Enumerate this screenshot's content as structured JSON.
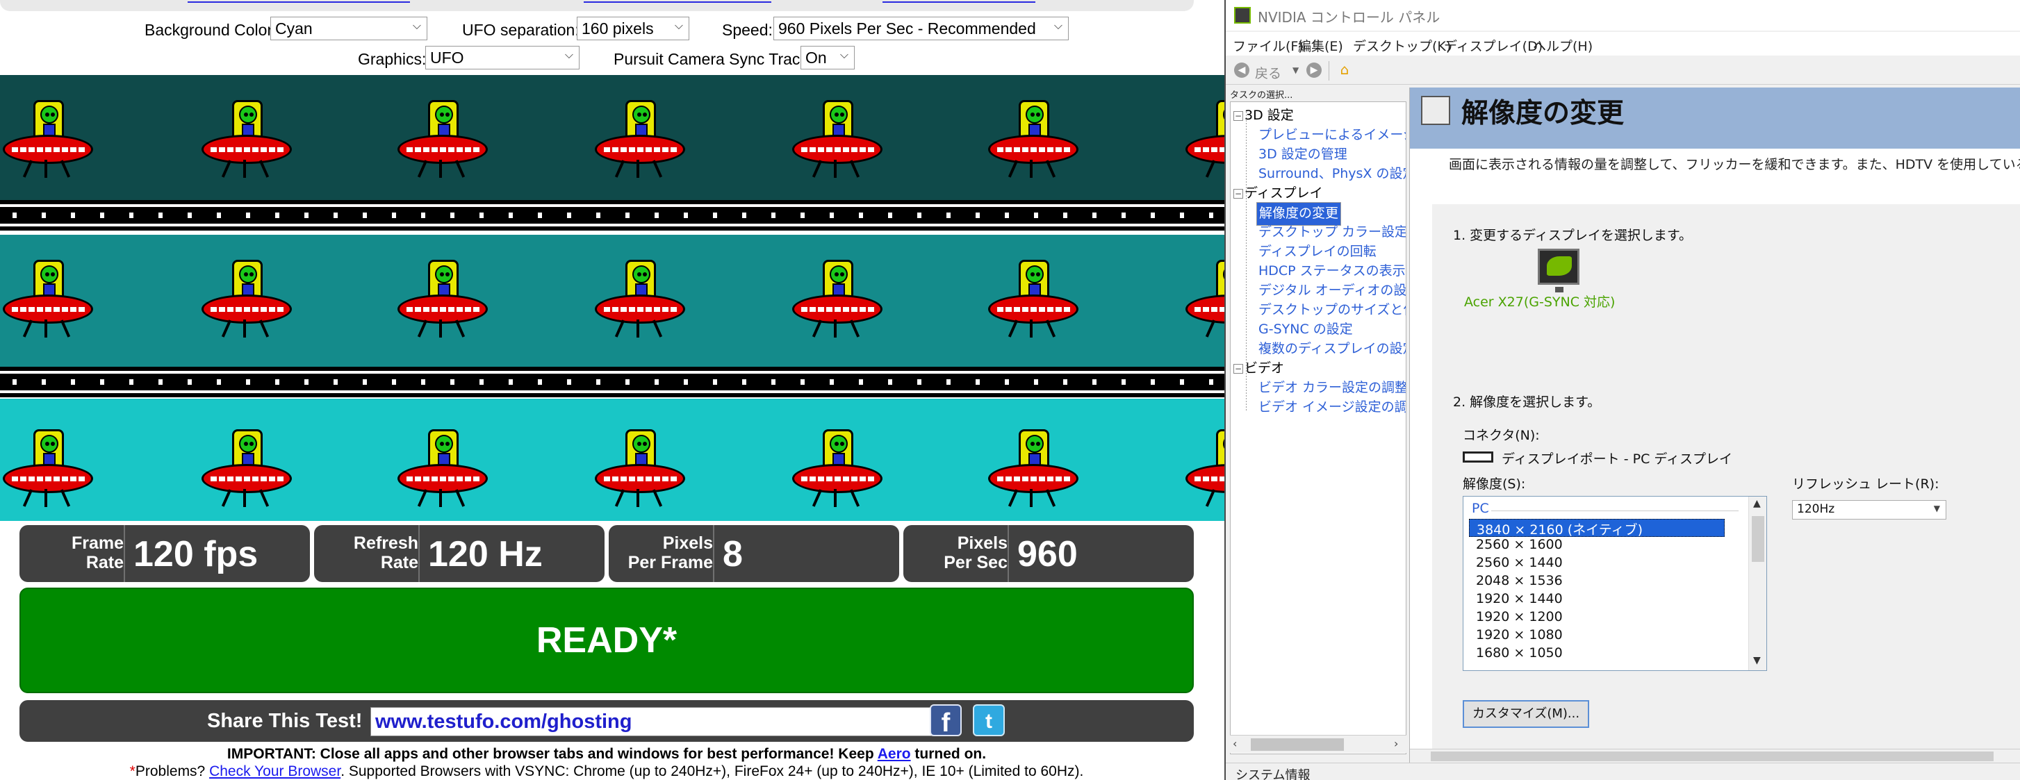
{
  "testufo": {
    "controls_row1": {
      "background_label": "Background Color:",
      "background_value": "Cyan",
      "separation_label": "UFO separation:",
      "separation_value": "160 pixels",
      "speed_label": "Speed:",
      "speed_value": "960 Pixels Per Sec - Recommended"
    },
    "controls_row2": {
      "graphics_label": "Graphics:",
      "graphics_value": "UFO",
      "sync_label": "Pursuit Camera Sync Track:",
      "sync_value": "On"
    },
    "bands": [
      {
        "color": "#0f4a4a"
      },
      {
        "color": "#148b8b"
      },
      {
        "color": "#19c6c6"
      }
    ],
    "stats": [
      {
        "label_line1": "Frame",
        "label_line2": "Rate",
        "value": "120 fps"
      },
      {
        "label_line1": "Refresh",
        "label_line2": "Rate",
        "value": "120 Hz"
      },
      {
        "label_line1": "Pixels",
        "label_line2": "Per Frame",
        "value": "8"
      },
      {
        "label_line1": "Pixels",
        "label_line2": "Per Sec",
        "value": "960"
      }
    ],
    "status": "READY*",
    "share": {
      "label": "Share This Test!",
      "url": "www.testufo.com/ghosting",
      "facebook_icon": "facebook-icon",
      "twitter_icon": "twitter-icon"
    },
    "notice": {
      "important_prefix": "IMPORTANT: Close all apps and other browser tabs and windows for best performance! Keep ",
      "aero_link": "Aero",
      "important_suffix": " turned on.",
      "star": "*",
      "problems": "Problems? ",
      "check_link": "Check Your Browser",
      "supported": ". Supported Browsers with VSYNC: Chrome (up to 240Hz+), FireFox 24+ (up to 240Hz+), IE 10+ (Limited to 60Hz)."
    }
  },
  "nvidia": {
    "title": "NVIDIA コントロール パネル",
    "menu": [
      "ファイル(F)",
      "編集(E)",
      "デスクトップ(K)",
      "ディスプレイ(D)",
      "ヘルプ(H)"
    ],
    "toolbar": {
      "back": "戻る"
    },
    "task_label": "タスクの選択...",
    "tree": {
      "cat_3d": "3D 設定",
      "items_3d": [
        "プレビューによるイメージ設定の調整",
        "3D 設定の管理",
        "Surround、PhysX の設定"
      ],
      "cat_display": "ディスプレイ",
      "items_display": [
        "解像度の変更",
        "デスクトップ カラー設定の調整",
        "ディスプレイの回転",
        "HDCP ステータスの表示",
        "デジタル オーディオの設定",
        "デスクトップのサイズと位置の調整",
        "G-SYNC の設定",
        "複数のディスプレイの設定"
      ],
      "cat_video": "ビデオ",
      "items_video": [
        "ビデオ カラー設定の調整",
        "ビデオ イメージ設定の調整"
      ]
    },
    "page_title": "解像度の変更",
    "description": "画面に表示される情報の量を調整して、フリッカーを緩和できます。また、HDTV を使用している場合にも...",
    "step1": "1. 変更するディスプレイを選択します。",
    "monitor_label": "Acer X27(G-SYNC 対応)",
    "step2": "2. 解像度を選択します。",
    "connector_label": "コネクタ(N):",
    "connector_value": "ディスプレイポート - PC ディスプレイ",
    "resolution_label": "解像度(S):",
    "refresh_label": "リフレッシュ レート(R):",
    "refresh_value": "120Hz",
    "resolution_group": "PC",
    "resolutions": [
      "3840 × 2160 (ネイティブ)",
      "2560 × 1600",
      "2560 × 1440",
      "2048 × 1536",
      "1920 × 1440",
      "1920 × 1200",
      "1920 × 1080",
      "1680 × 1050"
    ],
    "selected_resolution": "3840 × 2160 (ネイティブ)",
    "customize_button": "カスタマイズ(M)...",
    "system_info": "システム情報"
  }
}
